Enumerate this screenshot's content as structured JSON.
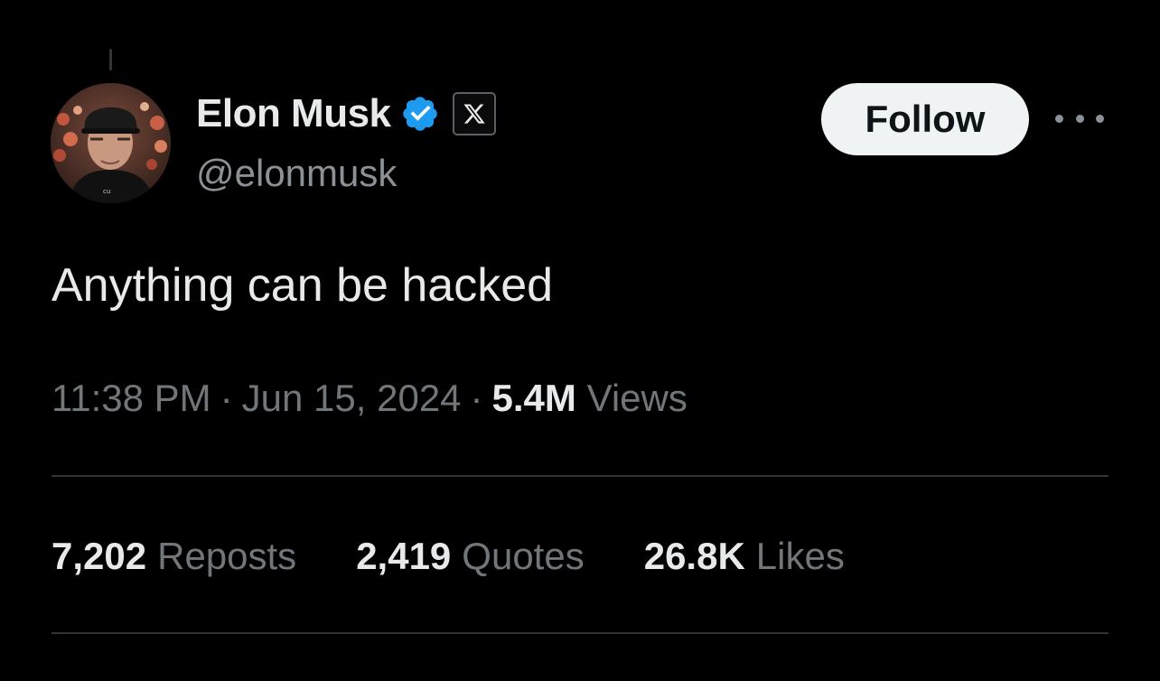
{
  "colors": {
    "background": "#000000",
    "primary_text": "#e7e9ea",
    "secondary_text": "#71767b",
    "verified_blue": "#1d9bf0",
    "follow_button_bg": "#eff3f4",
    "divider": "#2f3336"
  },
  "author": {
    "name": "Elon Musk",
    "handle": "@elonmusk",
    "verified_icon": "verified-badge-icon",
    "affiliate_icon": "x-logo-icon"
  },
  "actions": {
    "follow_label": "Follow",
    "more_icon": "more-horizontal-icon"
  },
  "tweet": {
    "text": "Anything can be hacked",
    "time": "11:38 PM",
    "separator": "·",
    "date": "Jun 15, 2024",
    "views_count": "5.4M",
    "views_label": "Views"
  },
  "stats": {
    "reposts": {
      "count": "7,202",
      "label": "Reposts"
    },
    "quotes": {
      "count": "2,419",
      "label": "Quotes"
    },
    "likes": {
      "count": "26.8K",
      "label": "Likes"
    }
  }
}
